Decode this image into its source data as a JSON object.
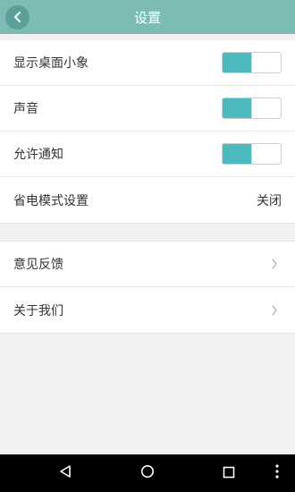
{
  "header": {
    "title": "设置",
    "back_icon": "chevron-left-icon"
  },
  "colors": {
    "header_bg": "#7cbcb5",
    "accent": "#4bbbbf"
  },
  "settings": [
    {
      "label": "显示桌面小象",
      "type": "toggle",
      "on": true
    },
    {
      "label": "声音",
      "type": "toggle",
      "on": true
    },
    {
      "label": "允许通知",
      "type": "toggle",
      "on": true
    },
    {
      "label": "省电模式设置",
      "type": "value",
      "value": "关闭"
    }
  ],
  "links": [
    {
      "label": "意见反馈",
      "icon": "chevron-right-icon"
    },
    {
      "label": "关于我们",
      "icon": "chevron-right-icon"
    }
  ],
  "navbar": {
    "icons": [
      "back-triangle-icon",
      "home-circle-icon",
      "recents-square-icon",
      "more-vertical-icon"
    ]
  }
}
